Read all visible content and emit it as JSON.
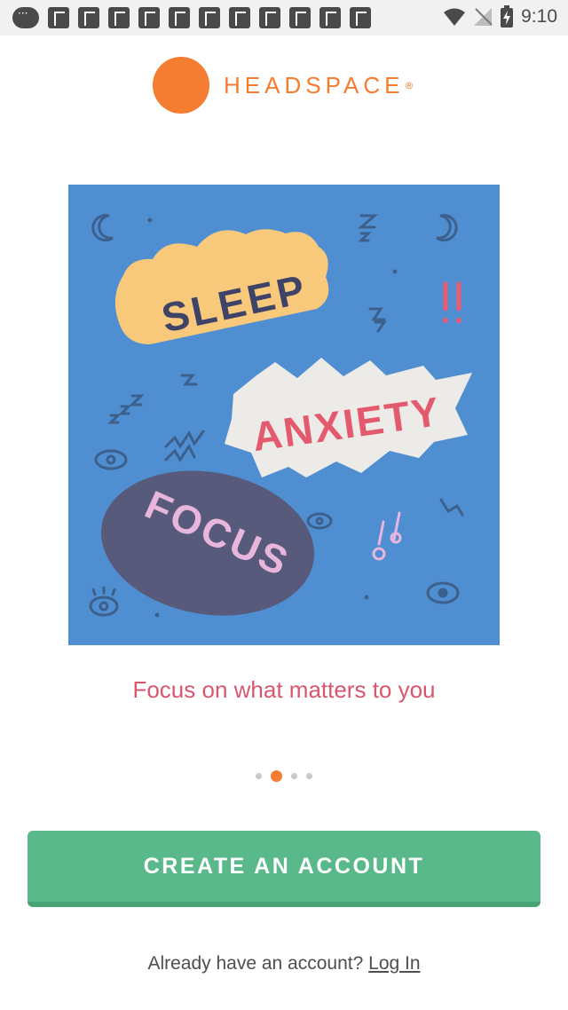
{
  "status_bar": {
    "time": "9:10"
  },
  "app": {
    "brand": "HEADSPACE",
    "brand_mark": "®",
    "accent": "#f47d31"
  },
  "hero": {
    "words": [
      "SLEEP",
      "ANXIETY",
      "FOCUS"
    ],
    "colors": {
      "background": "#4f8fd1",
      "sleep_cloud": "#f8c87b",
      "anxiety_burst": "#ecebe7",
      "focus_oval": "#575a7a",
      "sleep_text": "#3e4467",
      "anxiety_text": "#e35a6e",
      "focus_text": "#e8b5dc"
    }
  },
  "onboarding": {
    "tagline": "Focus on what matters to you",
    "pages_total": 4,
    "active_page": 2
  },
  "actions": {
    "create_account": "CREATE AN ACCOUNT",
    "login_prompt": "Already have an account?",
    "login_link": "Log In"
  }
}
